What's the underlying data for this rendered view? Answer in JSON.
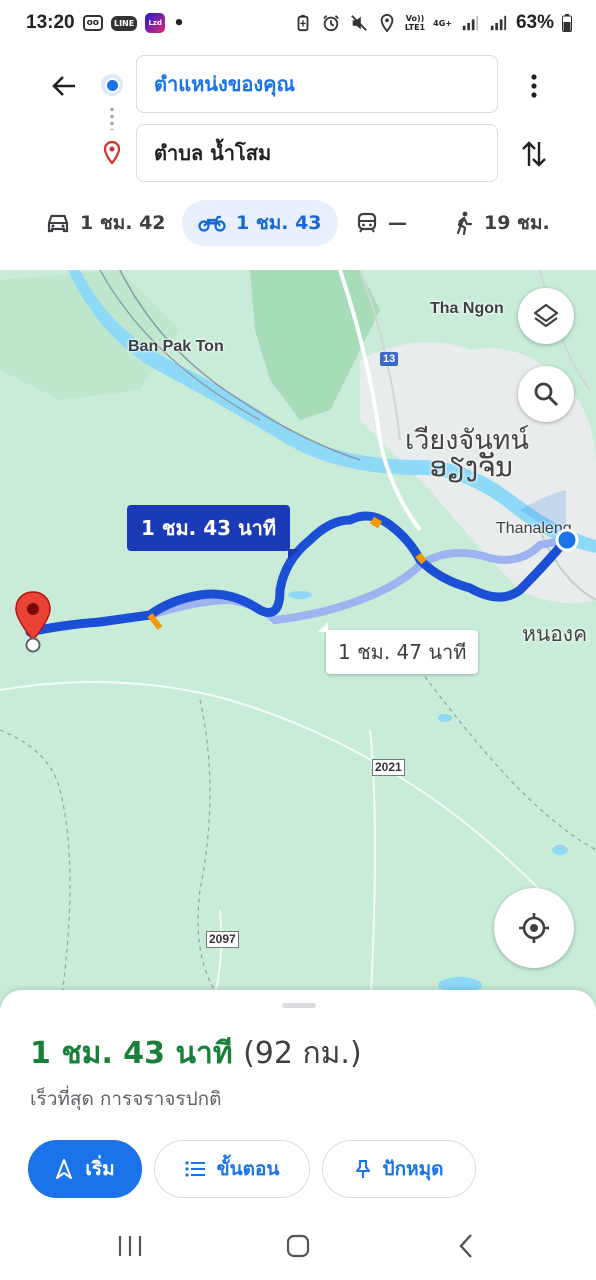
{
  "status_bar": {
    "time": "13:20",
    "line_badge": "LINE",
    "lazada_badge": "Lzd",
    "dot": "•",
    "network_top": "Vo))",
    "network_bottom": "LTE1",
    "network_type": "4G+",
    "battery_percent": "63%"
  },
  "directions": {
    "origin": "ตำแหน่งของคุณ",
    "destination": "ตำบล น้ำโสม"
  },
  "modes": [
    {
      "name": "car",
      "label": "1 ชม. 42",
      "active": false
    },
    {
      "name": "motorbike",
      "label": "1 ชม. 43",
      "active": true
    },
    {
      "name": "transit",
      "label": "—",
      "active": false
    },
    {
      "name": "walk",
      "label": "19 ชม.",
      "active": false
    }
  ],
  "map": {
    "places": {
      "tha_ngon": "Tha Ngon",
      "ban_pak_ton": "Ban Pak Ton",
      "vientiane_line1": "เวียงจันทน์",
      "vientiane_line2": "ອຽງຈັນ",
      "thanaleng": "Thanaleng",
      "nong_khai": "หนองค"
    },
    "road_shields": {
      "route_13": "13",
      "route_2021": "2021",
      "route_2097": "2097"
    },
    "route_primary_label": "1 ชม. 43 นาที",
    "route_alt_label": "1 ชม. 47 นาที",
    "colors": {
      "route_primary": "#1a4fd6",
      "route_alt": "#9db4f0",
      "water": "#8ed8f8",
      "land": "#c9ecd8"
    }
  },
  "sheet": {
    "duration": "1 ชม. 43 นาที",
    "distance": "(92 กม.)",
    "subtitle": "เร็วที่สุด การจราจรปกติ",
    "buttons": {
      "start": "เริ่ม",
      "steps": "ขั้นตอน",
      "pin": "ปักหมุด"
    }
  }
}
